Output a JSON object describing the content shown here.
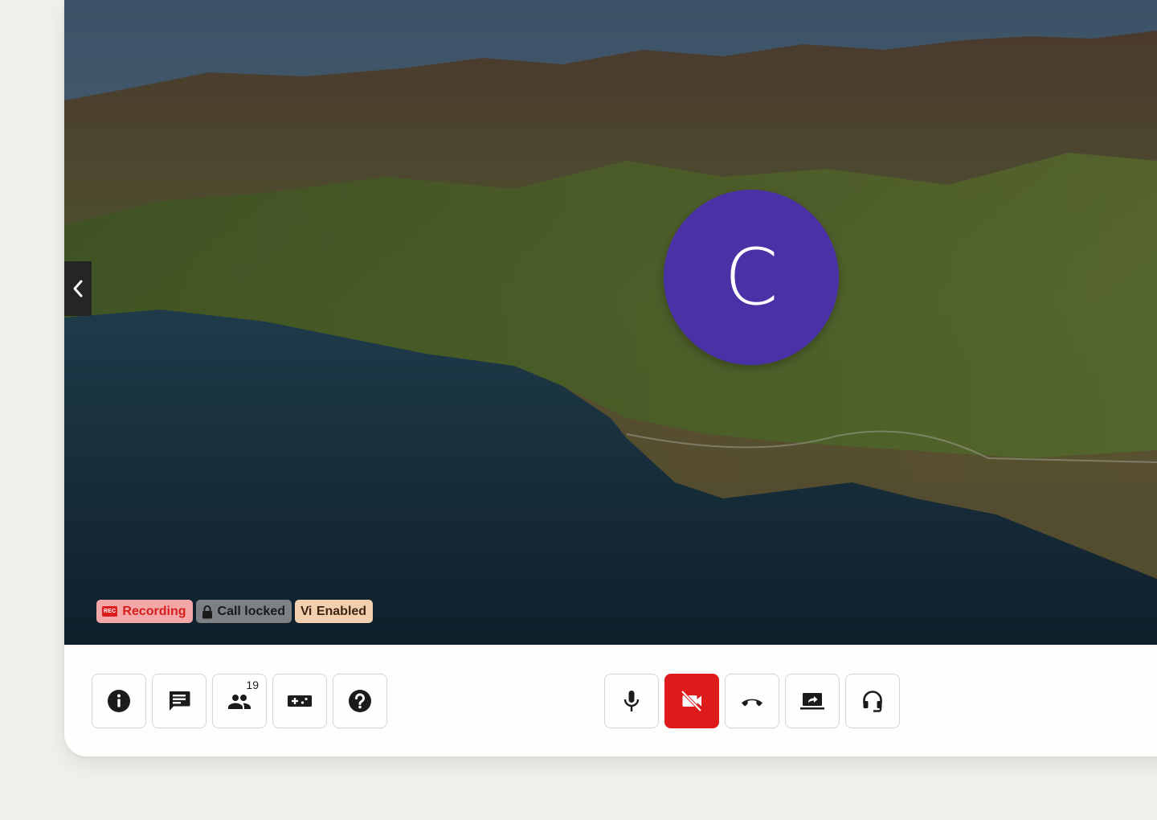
{
  "stage": {
    "participant": {
      "initial": "C",
      "avatar_color": "#4a32a6"
    },
    "side_panel_toggle": {
      "icon": "chevron-left-icon"
    },
    "badges": [
      {
        "chip": "REC",
        "label": "Recording",
        "icon": "rec-icon"
      },
      {
        "chip": "",
        "label": "Call locked",
        "icon": "lock-icon"
      },
      {
        "chip": "Vi",
        "label": "Enabled",
        "icon": "vi-icon"
      }
    ]
  },
  "toolbar": {
    "left": [
      {
        "name": "info",
        "icon": "info-icon"
      },
      {
        "name": "chat",
        "icon": "chat-icon"
      },
      {
        "name": "participants",
        "icon": "people-icon",
        "count": "19"
      },
      {
        "name": "games",
        "icon": "gamepad-icon"
      },
      {
        "name": "help",
        "icon": "help-icon"
      }
    ],
    "center": [
      {
        "name": "microphone",
        "icon": "microphone-icon",
        "state": "on"
      },
      {
        "name": "camera",
        "icon": "camera-off-icon",
        "state": "off"
      },
      {
        "name": "hang-up",
        "icon": "phone-hangup-icon"
      },
      {
        "name": "share-screen",
        "icon": "screen-share-icon"
      },
      {
        "name": "audio-settings",
        "icon": "headset-icon"
      }
    ]
  },
  "colors": {
    "danger": "#de1a1a",
    "recording_badge_bg": "#f3a7a7",
    "locked_badge_bg": "#7d8186",
    "vi_badge_bg": "#f2cfae",
    "page_bg": "#f1f0ea"
  }
}
